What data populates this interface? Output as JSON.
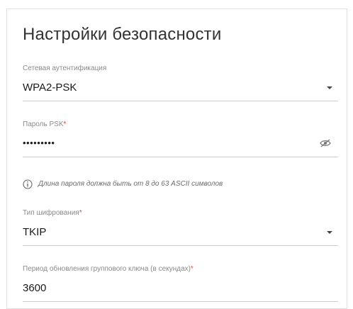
{
  "section": {
    "title": "Настройки безопасности"
  },
  "fields": {
    "auth": {
      "label": "Сетевая аутентификация",
      "value": "WPA2-PSK"
    },
    "psk": {
      "label": "Пароль PSK",
      "required_mark": "*",
      "value": "•••••••••"
    },
    "hint": {
      "text": "Длина пароля должна быть от 8 до 63 ASCII символов"
    },
    "cipher": {
      "label": "Тип шифрования",
      "required_mark": "*",
      "value": "TKIP"
    },
    "group_key": {
      "label": "Период обновления группового ключа (в секундах)",
      "required_mark": "*",
      "value": "3600"
    }
  },
  "icons": {
    "dropdown": "chevron-down-icon",
    "password_visibility": "eye-icon",
    "info": "info-icon"
  },
  "colors": {
    "required": "#e2463b",
    "label": "#8a8a8a",
    "value": "#1a1a1a",
    "border": "#cfcfcf"
  }
}
